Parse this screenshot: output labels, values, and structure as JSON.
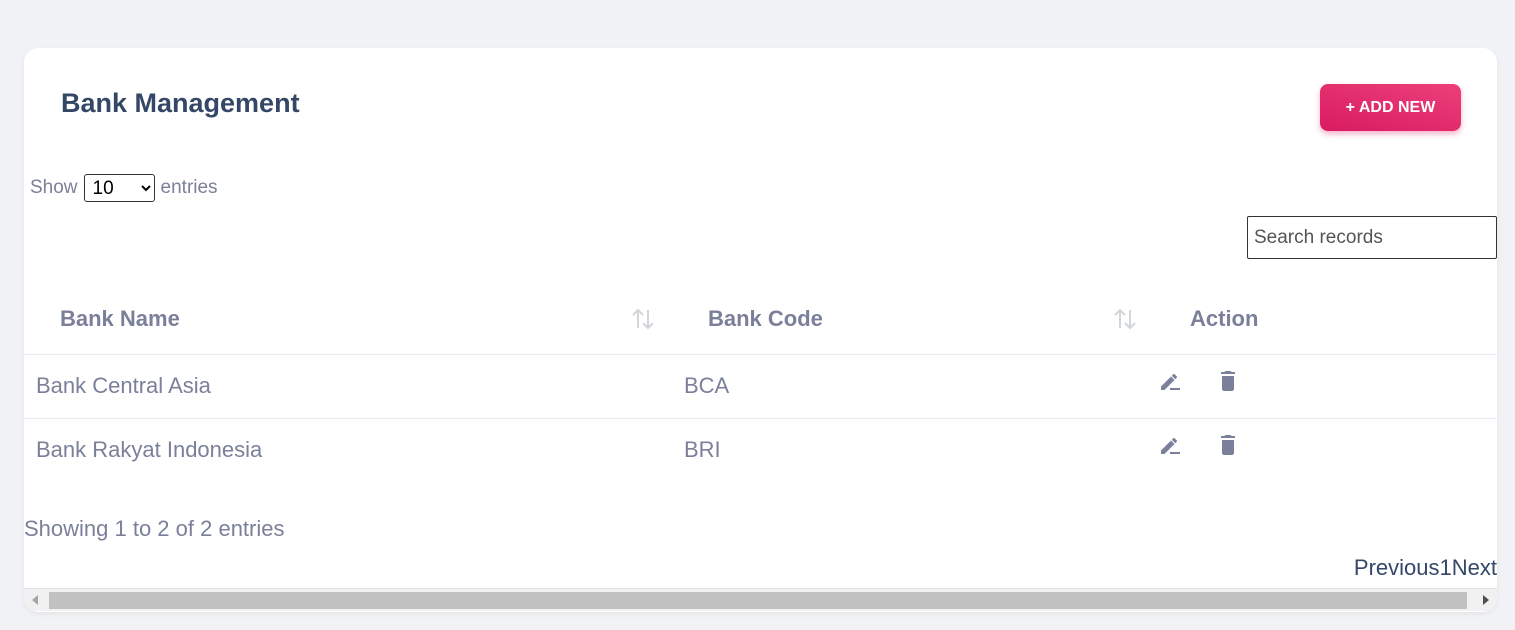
{
  "header": {
    "title": "Bank Management",
    "add_button_label": "+ ADD NEW"
  },
  "length_control": {
    "show_label": "Show",
    "selected": "10",
    "options": [
      "10"
    ],
    "entries_label": "entries"
  },
  "search": {
    "placeholder": "Search records",
    "value": ""
  },
  "table": {
    "columns": [
      "Bank Name",
      "Bank Code",
      "Action"
    ],
    "rows": [
      {
        "name": "Bank Central Asia",
        "code": "BCA"
      },
      {
        "name": "Bank Rakyat Indonesia",
        "code": "BRI"
      }
    ]
  },
  "footer": {
    "info": "Showing 1 to 2 of 2 entries",
    "previous": "Previous",
    "page": "1",
    "next": "Next"
  },
  "icons": {
    "sort": "sort-arrows-icon",
    "edit": "edit-pencil-icon",
    "delete": "trash-icon"
  },
  "colors": {
    "accent": "#e91e63",
    "title": "#344767",
    "text_muted": "#7b809a",
    "background": "#f0f2f5"
  }
}
